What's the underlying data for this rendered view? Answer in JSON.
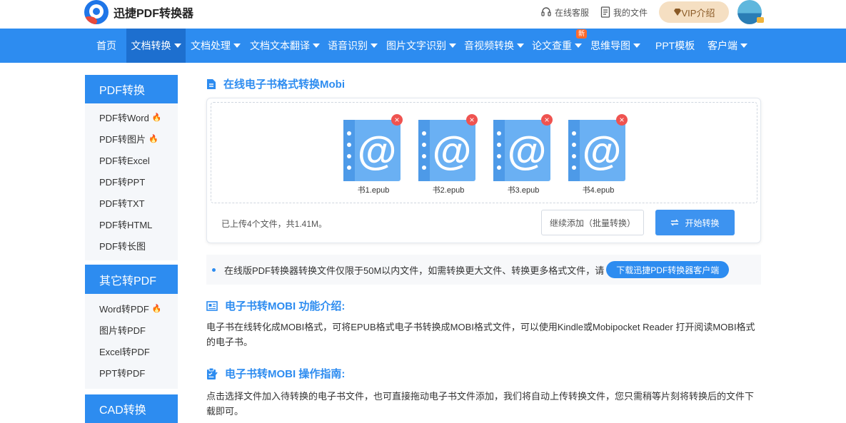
{
  "brand": {
    "name": "迅捷PDF转换器"
  },
  "header": {
    "service": "在线客服",
    "my_files": "我的文件",
    "vip": "VIP介绍"
  },
  "nav": {
    "items": [
      {
        "label": "首页"
      },
      {
        "label": "文档转换"
      },
      {
        "label": "文档处理"
      },
      {
        "label": "文档文本翻译"
      },
      {
        "label": "语音识别"
      },
      {
        "label": "图片文字识别"
      },
      {
        "label": "音视频转换"
      },
      {
        "label": "论文查重",
        "badge": "新"
      },
      {
        "label": "思维导图"
      },
      {
        "label": "PPT模板"
      },
      {
        "label": "客户端"
      }
    ]
  },
  "sidebar": {
    "groups": [
      {
        "title": "PDF转换",
        "items": [
          "PDF转Word",
          "PDF转图片",
          "PDF转Excel",
          "PDF转PPT",
          "PDF转TXT",
          "PDF转HTML",
          "PDF转长图"
        ]
      },
      {
        "title": "其它转PDF",
        "items": [
          "Word转PDF",
          "图片转PDF",
          "Excel转PDF",
          "PPT转PDF"
        ]
      },
      {
        "title": "CAD转换",
        "items": []
      }
    ]
  },
  "main": {
    "title": "在线电子书格式转换Mobi",
    "files": [
      "书1.epub",
      "书2.epub",
      "书3.epub",
      "书4.epub"
    ],
    "upload_info": "已上传4个文件，共1.41M。",
    "add_button": "继续添加（批量转换）",
    "start_button": "开始转换",
    "notice": "在线版PDF转换器转换文件仅限于50M以内文件，如需转换更大文件、转换更多格式文件，请",
    "download_button": "下载迅捷PDF转换器客户端",
    "intro_title": "电子书转MOBI 功能介绍:",
    "intro_text": "电子书在线转化成MOBI格式，可将EPUB格式电子书转换成MOBI格式文件，可以使用Kindle或Mobipocket Reader 打开阅读MOBI格式的电子书。",
    "guide_title": "电子书转MOBI 操作指南:",
    "guide_text": "点击选择文件加入待转换的电子书文件，也可直接拖动电子书文件添加，我们将自动上传转换文件，您只需稍等片刻将转换后的文件下载即可。"
  },
  "colors": {
    "accent": "#2d8cf0",
    "nav_active": "#1d6fcf",
    "delete": "#ef5350",
    "vip": "#f5dfc2"
  }
}
